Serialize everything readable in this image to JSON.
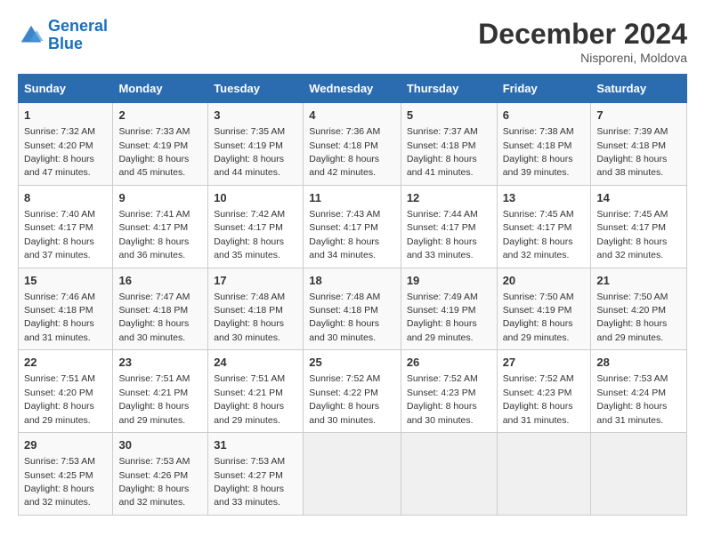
{
  "logo": {
    "line1": "General",
    "line2": "Blue"
  },
  "title": "December 2024",
  "subtitle": "Nisporeni, Moldova",
  "header_days": [
    "Sunday",
    "Monday",
    "Tuesday",
    "Wednesday",
    "Thursday",
    "Friday",
    "Saturday"
  ],
  "weeks": [
    [
      {
        "day": "1",
        "sunrise": "7:32 AM",
        "sunset": "4:20 PM",
        "daylight": "8 hours and 47 minutes."
      },
      {
        "day": "2",
        "sunrise": "7:33 AM",
        "sunset": "4:19 PM",
        "daylight": "8 hours and 45 minutes."
      },
      {
        "day": "3",
        "sunrise": "7:35 AM",
        "sunset": "4:19 PM",
        "daylight": "8 hours and 44 minutes."
      },
      {
        "day": "4",
        "sunrise": "7:36 AM",
        "sunset": "4:18 PM",
        "daylight": "8 hours and 42 minutes."
      },
      {
        "day": "5",
        "sunrise": "7:37 AM",
        "sunset": "4:18 PM",
        "daylight": "8 hours and 41 minutes."
      },
      {
        "day": "6",
        "sunrise": "7:38 AM",
        "sunset": "4:18 PM",
        "daylight": "8 hours and 39 minutes."
      },
      {
        "day": "7",
        "sunrise": "7:39 AM",
        "sunset": "4:18 PM",
        "daylight": "8 hours and 38 minutes."
      }
    ],
    [
      {
        "day": "8",
        "sunrise": "7:40 AM",
        "sunset": "4:17 PM",
        "daylight": "8 hours and 37 minutes."
      },
      {
        "day": "9",
        "sunrise": "7:41 AM",
        "sunset": "4:17 PM",
        "daylight": "8 hours and 36 minutes."
      },
      {
        "day": "10",
        "sunrise": "7:42 AM",
        "sunset": "4:17 PM",
        "daylight": "8 hours and 35 minutes."
      },
      {
        "day": "11",
        "sunrise": "7:43 AM",
        "sunset": "4:17 PM",
        "daylight": "8 hours and 34 minutes."
      },
      {
        "day": "12",
        "sunrise": "7:44 AM",
        "sunset": "4:17 PM",
        "daylight": "8 hours and 33 minutes."
      },
      {
        "day": "13",
        "sunrise": "7:45 AM",
        "sunset": "4:17 PM",
        "daylight": "8 hours and 32 minutes."
      },
      {
        "day": "14",
        "sunrise": "7:45 AM",
        "sunset": "4:17 PM",
        "daylight": "8 hours and 32 minutes."
      }
    ],
    [
      {
        "day": "15",
        "sunrise": "7:46 AM",
        "sunset": "4:18 PM",
        "daylight": "8 hours and 31 minutes."
      },
      {
        "day": "16",
        "sunrise": "7:47 AM",
        "sunset": "4:18 PM",
        "daylight": "8 hours and 30 minutes."
      },
      {
        "day": "17",
        "sunrise": "7:48 AM",
        "sunset": "4:18 PM",
        "daylight": "8 hours and 30 minutes."
      },
      {
        "day": "18",
        "sunrise": "7:48 AM",
        "sunset": "4:18 PM",
        "daylight": "8 hours and 30 minutes."
      },
      {
        "day": "19",
        "sunrise": "7:49 AM",
        "sunset": "4:19 PM",
        "daylight": "8 hours and 29 minutes."
      },
      {
        "day": "20",
        "sunrise": "7:50 AM",
        "sunset": "4:19 PM",
        "daylight": "8 hours and 29 minutes."
      },
      {
        "day": "21",
        "sunrise": "7:50 AM",
        "sunset": "4:20 PM",
        "daylight": "8 hours and 29 minutes."
      }
    ],
    [
      {
        "day": "22",
        "sunrise": "7:51 AM",
        "sunset": "4:20 PM",
        "daylight": "8 hours and 29 minutes."
      },
      {
        "day": "23",
        "sunrise": "7:51 AM",
        "sunset": "4:21 PM",
        "daylight": "8 hours and 29 minutes."
      },
      {
        "day": "24",
        "sunrise": "7:51 AM",
        "sunset": "4:21 PM",
        "daylight": "8 hours and 29 minutes."
      },
      {
        "day": "25",
        "sunrise": "7:52 AM",
        "sunset": "4:22 PM",
        "daylight": "8 hours and 30 minutes."
      },
      {
        "day": "26",
        "sunrise": "7:52 AM",
        "sunset": "4:23 PM",
        "daylight": "8 hours and 30 minutes."
      },
      {
        "day": "27",
        "sunrise": "7:52 AM",
        "sunset": "4:23 PM",
        "daylight": "8 hours and 31 minutes."
      },
      {
        "day": "28",
        "sunrise": "7:53 AM",
        "sunset": "4:24 PM",
        "daylight": "8 hours and 31 minutes."
      }
    ],
    [
      {
        "day": "29",
        "sunrise": "7:53 AM",
        "sunset": "4:25 PM",
        "daylight": "8 hours and 32 minutes."
      },
      {
        "day": "30",
        "sunrise": "7:53 AM",
        "sunset": "4:26 PM",
        "daylight": "8 hours and 32 minutes."
      },
      {
        "day": "31",
        "sunrise": "7:53 AM",
        "sunset": "4:27 PM",
        "daylight": "8 hours and 33 minutes."
      },
      null,
      null,
      null,
      null
    ]
  ]
}
